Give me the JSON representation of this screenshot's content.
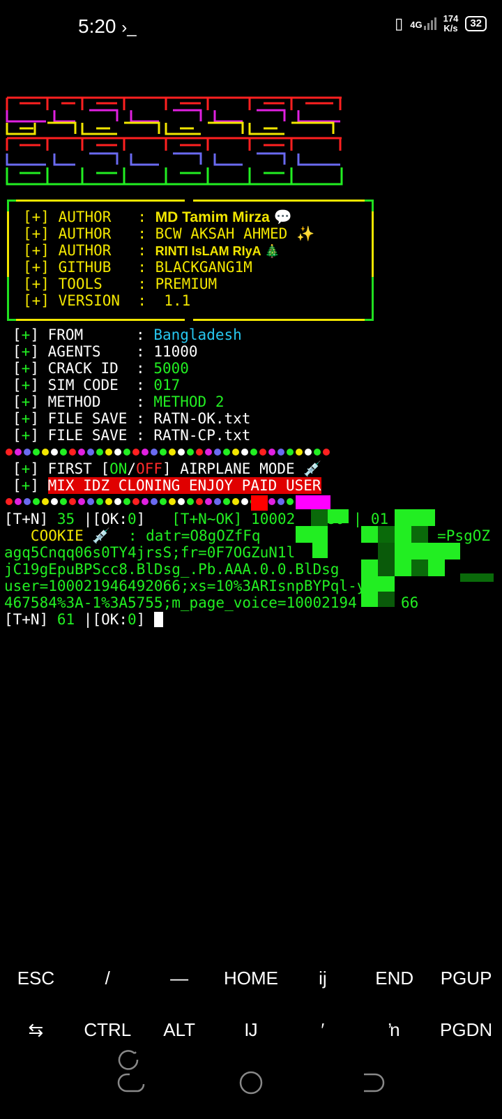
{
  "status": {
    "time": "5:20",
    "prompt_icon": "terminal-prompt-icon",
    "net_top": "4G",
    "speed": "174",
    "speed_unit": "K/s",
    "battery": "32"
  },
  "info_box": {
    "rows": [
      {
        "label": "[+] AUTHOR   : ",
        "value": "MD Tamim Mirza 💬"
      },
      {
        "label": "[+] AUTHOR   : ",
        "value": "BCW AKSAH AHMED ✨"
      },
      {
        "label": "[+] AUTHOR   : ",
        "value": "RINTI IsLAM RIyA 🎄"
      },
      {
        "label": "[+] GITHUB   : ",
        "value": "BLACKGANG1M"
      },
      {
        "label": "[+] TOOLS    : ",
        "value": "PREMIUM"
      },
      {
        "label": "[+] VERSION  : ",
        "value": " 1.1"
      }
    ]
  },
  "details": [
    {
      "label": "FROM      ",
      "value": "Bangladesh"
    },
    {
      "label": "AGENTS    ",
      "value": "11000"
    },
    {
      "label": "CRACK ID  ",
      "value": "5000"
    },
    {
      "label": "SIM CODE  ",
      "value": "017"
    },
    {
      "label": "METHOD    ",
      "value": "METHOD 2"
    },
    {
      "label": "FILE SAVE ",
      "value": "RATN-OK.txt"
    },
    {
      "label": "FILE SAVE ",
      "value": "RATN-CP.txt"
    }
  ],
  "notice": {
    "first": "FIRST [",
    "on": "ON",
    "slash": "/",
    "off": "OFF",
    "rest": "] AIRPLANE MODE 💉",
    "paid": "MIX IDZ CLONING ENJOY PAID USER"
  },
  "log": {
    "line1": "[T+N] 35 |[OK:0]   [T+N~OK] 10002",
    "line1_tail": "280 | 01    6",
    "cookie": "  COOKIE 💉  : datr=O8gOZfFq",
    "cookie_tail": "AqmP    =PsgOZ",
    "c2": "agq5Cnqq06s0TY4jrsS;fr=0F7OGZuN1l",
    "c3": "jC19gEpuBPScc8.BlDsg_.Pb.AAA.0.0.BlDsg",
    "c4": "user=100021946492066;xs=10%3ARIsnpBYPql-y",
    "c5": "467584%3A-1%3A5755;m_page_voice=10002194     66",
    "last": "[T+N] 61 |[OK:0] "
  },
  "keys_row1": [
    "ESC",
    "/",
    "—",
    "HOME",
    "ij",
    "END",
    "PGUP"
  ],
  "keys_row2": [
    "⇆",
    "CTRL",
    "ALT",
    "Ĳ",
    "′",
    "ŉ",
    "PGDN"
  ],
  "colors": {
    "green": "#22ee22",
    "yellow": "#f2e600",
    "cyan": "#27c7f0",
    "red": "#e00000"
  }
}
